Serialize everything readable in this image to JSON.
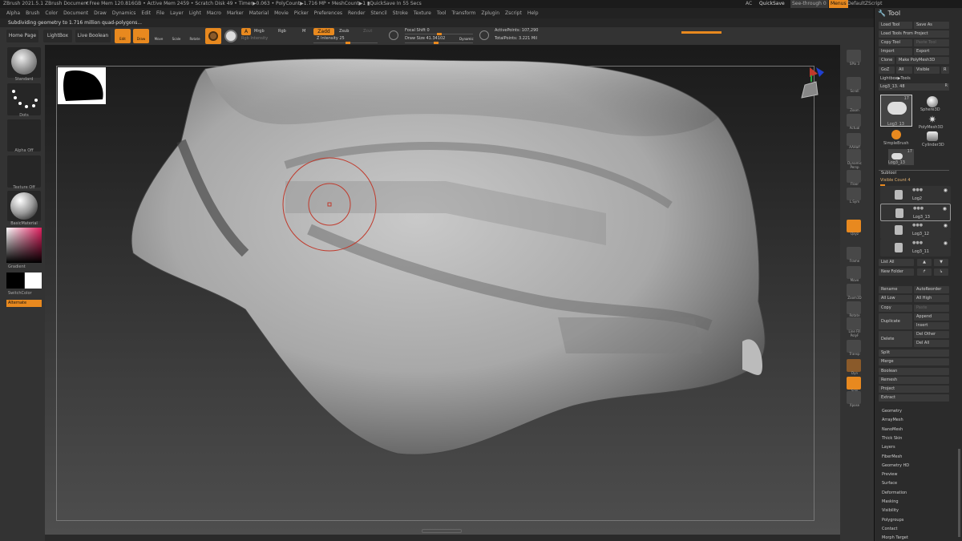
{
  "titlebar": {
    "app": "ZBrush 2021.5.1",
    "doc": "ZBrush Document",
    "stats": "• Free Mem 120.816GB • Active Mem 2459 • Scratch Disk 49 • Timer▶0.063 • PolyCount▶1.716 MP • MeshCount▶1 ▮QuickSave In 55 Secs",
    "ac": "AC",
    "quicksave": "QuickSave",
    "seethrough": "See-through",
    "seethrough_val": "0",
    "menus": "Menus",
    "zscript": "DefaultZScript"
  },
  "menubar": [
    "Alpha",
    "Brush",
    "Color",
    "Document",
    "Draw",
    "Dynamics",
    "Edit",
    "File",
    "Layer",
    "Light",
    "Macro",
    "Marker",
    "Material",
    "Movie",
    "Picker",
    "Preferences",
    "Render",
    "Stencil",
    "Stroke",
    "Texture",
    "Tool",
    "Transform",
    "Zplugin",
    "Zscript",
    "Help"
  ],
  "status": {
    "message": "Subdividing geometry to 1.716 million quad-polygons..."
  },
  "toolbar": {
    "home": "Home Page",
    "lightbox": "LightBox",
    "liveboolean": "Live Boolean",
    "edit": "Edit",
    "draw": "Draw",
    "move": "Move",
    "scale": "Scale",
    "rotate": "Rotate",
    "a": "A",
    "mrgb": "Mrgb",
    "rgb": "Rgb",
    "m": "M",
    "rgb_intensity": "Rgb Intensity",
    "zadd": "Zadd",
    "zsub": "Zsub",
    "zcut": "Zcut",
    "z_intensity": "Z Intensity 25",
    "focal_shift": "Focal Shift 0",
    "draw_size": "Draw Size 41.34102",
    "dynamic": "Dynamic",
    "active_points": "ActivePoints: 107,290",
    "total_points": "TotalPoints: 3.221 Mil"
  },
  "leftshelf": {
    "brush": "Standard",
    "stroke": "Dots",
    "alpha": "Alpha Off",
    "texture": "Texture Off",
    "material": "BasicMaterial",
    "gradient": "Gradient",
    "switchcolor": "SwitchColor",
    "alternate": "Alternate"
  },
  "rightshelf": [
    "SPix 3",
    "Scroll",
    "Zoom",
    "Actual",
    "AAHalf",
    "Dynamic Persp",
    "Floor",
    "L.Sym",
    "Qxyz",
    "Frame",
    "Move",
    "Zoom3D",
    "Rotate",
    "Line Fill PolyF",
    "Transp",
    "Dyn",
    "Solo",
    "Xpose"
  ],
  "toolpanel": {
    "title": "Tool",
    "load_tool": "Load Tool",
    "save_as": "Save As",
    "load_project": "Load Tools From Project",
    "copy_tool": "Copy Tool",
    "paste_tool": "Paste Tool",
    "import": "Import",
    "export": "Export",
    "clone": "Clone",
    "make_polymesh": "Make PolyMesh3D",
    "goz": "GoZ",
    "all": "All",
    "visible": "Visible",
    "r": "R",
    "lightbox_tools": "Lightbox▶Tools",
    "current_tool": "Log3_13. 48",
    "thumbs": [
      {
        "label": "Log3_13",
        "count": "17"
      },
      {
        "label": "Sphere3D",
        "count": ""
      },
      {
        "label": "SimpleBrush",
        "count": ""
      },
      {
        "label": "PolyMesh3D",
        "count": ""
      },
      {
        "label": "Cylinder3D",
        "count": ""
      },
      {
        "label": "Log3_13",
        "count": "17"
      }
    ],
    "subtool": "Subtool",
    "visible_count": "Visible Count 4",
    "subtools": [
      "Log2",
      "Log3_13",
      "Log3_12",
      "Log3_11"
    ],
    "list_all": "List All",
    "new_folder": "New Folder",
    "rename": "Rename",
    "autoreorder": "AutoReorder",
    "all_low": "All Low",
    "all_high": "All High",
    "copy": "Copy",
    "paste": "Paste",
    "duplicate": "Duplicate",
    "append": "Append",
    "insert": "Insert",
    "delete": "Delete",
    "del_other": "Del Other",
    "del_all": "Del All",
    "split": "Split",
    "merge": "Merge",
    "boolean": "Boolean",
    "remesh": "Remesh",
    "project": "Project",
    "extract": "Extract",
    "sections": [
      "Geometry",
      "ArrayMesh",
      "NanoMesh",
      "Thick Skin",
      "Layers",
      "FiberMesh",
      "Geometry HD",
      "Preview",
      "Surface",
      "Deformation",
      "Masking",
      "Visibility",
      "Polygroups",
      "Contact",
      "Morph Target"
    ]
  },
  "colors": {
    "accent": "#e8891f",
    "panel": "#333333",
    "brush_ring": "#c0392b"
  }
}
